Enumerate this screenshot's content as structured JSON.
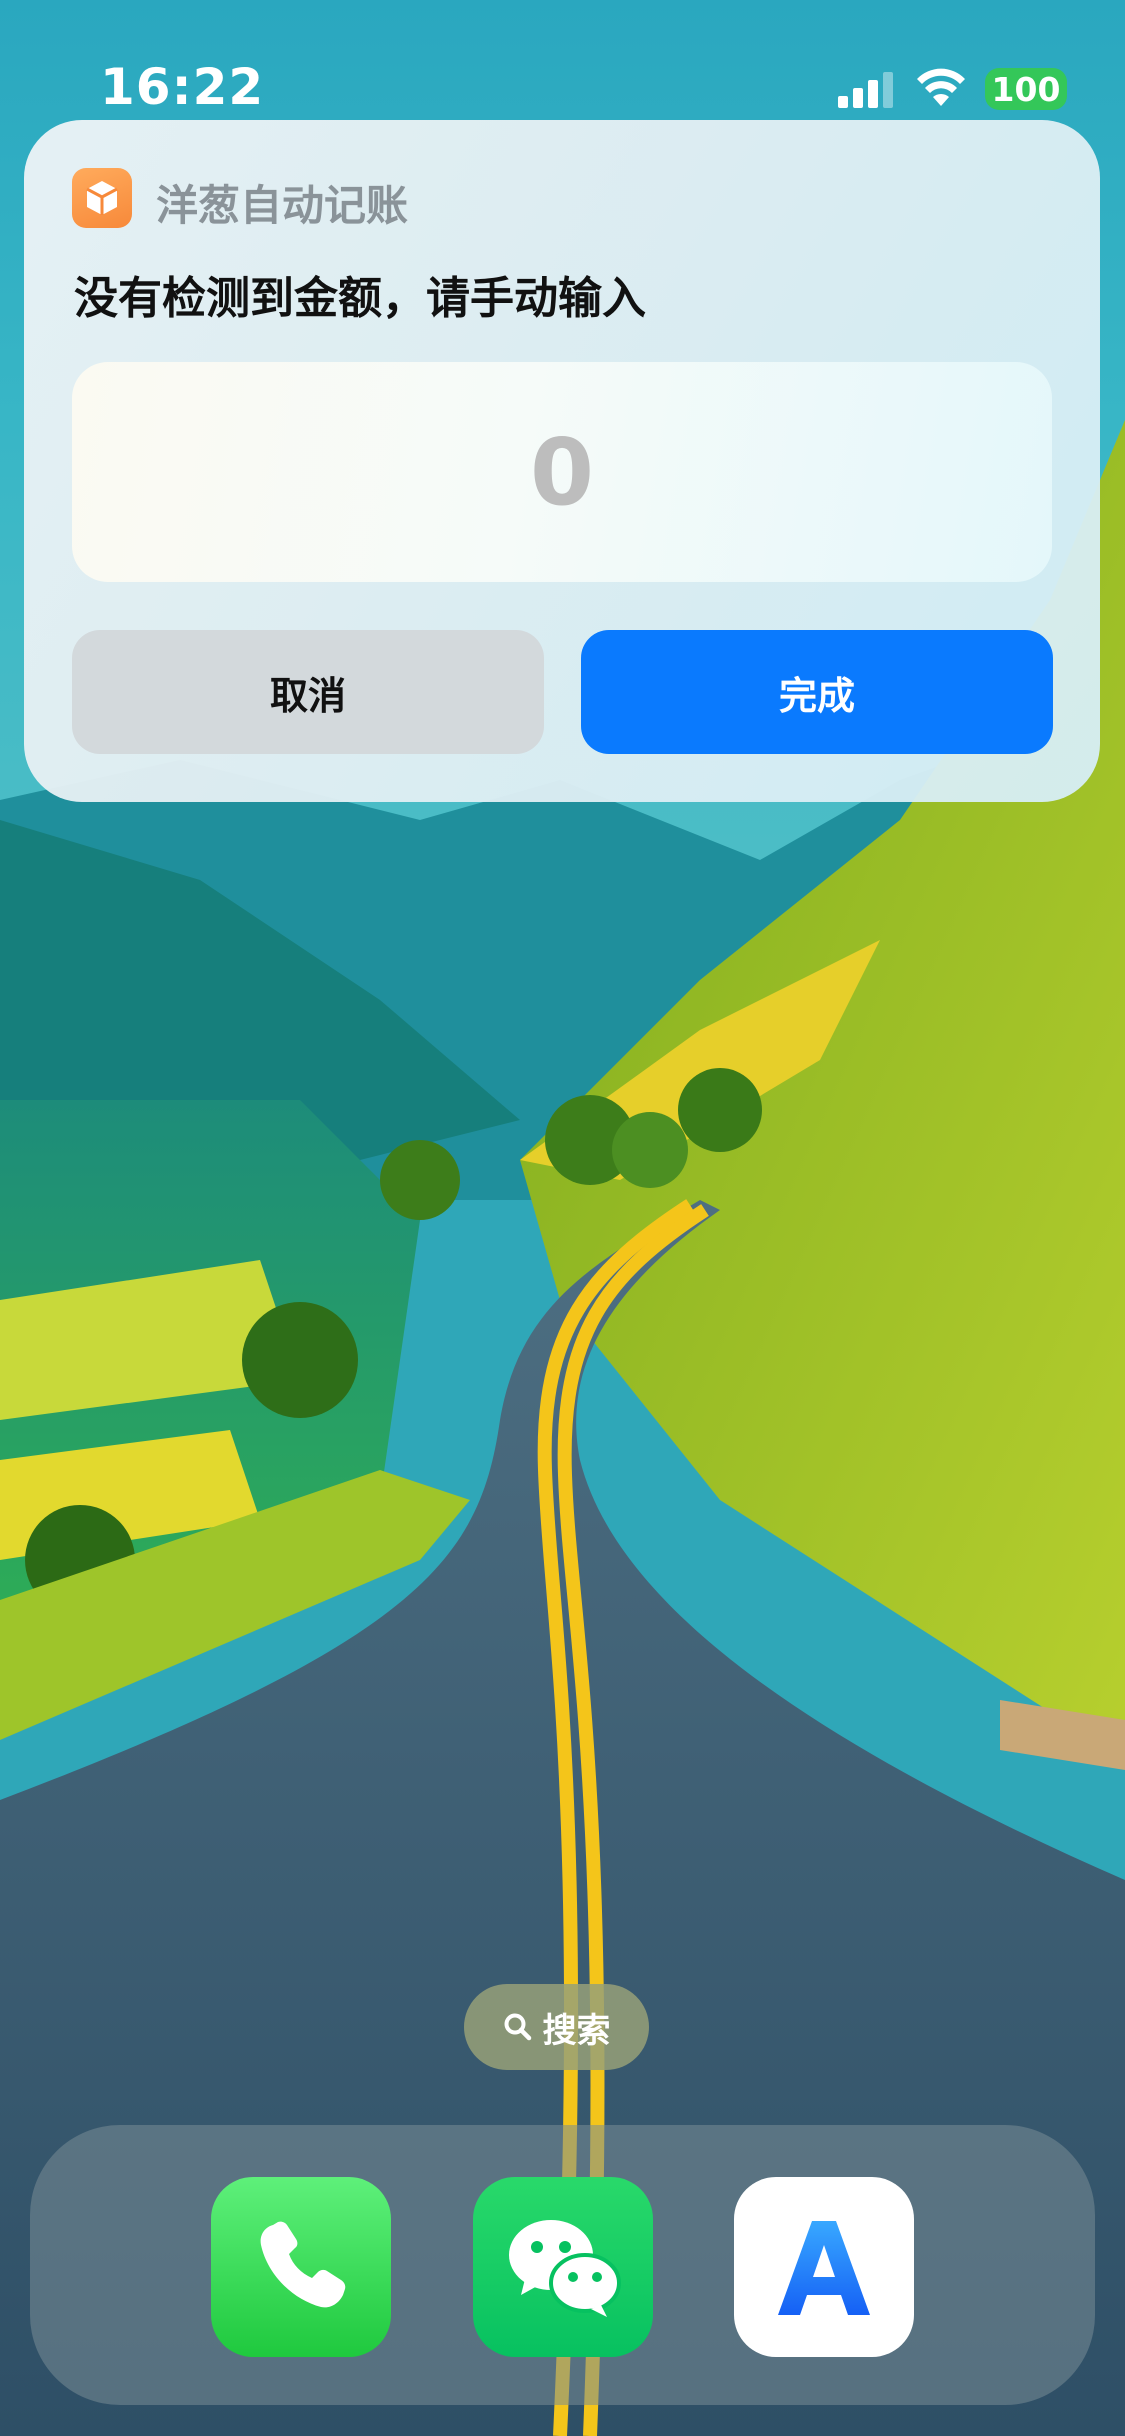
{
  "status_bar": {
    "time": "16:22",
    "battery": "100"
  },
  "notification": {
    "app_name": "洋葱自动记账",
    "title": "没有检测到金额，请手动输入",
    "amount_value": "0",
    "cancel_label": "取消",
    "done_label": "完成"
  },
  "search": {
    "label": "搜索",
    "icon": "search-icon"
  },
  "dock": {
    "apps": [
      {
        "name": "phone",
        "icon": "phone-icon"
      },
      {
        "name": "wechat",
        "icon": "wechat-icon"
      },
      {
        "name": "app-store",
        "icon": "app-store-icon"
      }
    ]
  },
  "colors": {
    "done_button": "#0a7afe",
    "battery": "#34c759",
    "app_icon": "#f7893a"
  }
}
